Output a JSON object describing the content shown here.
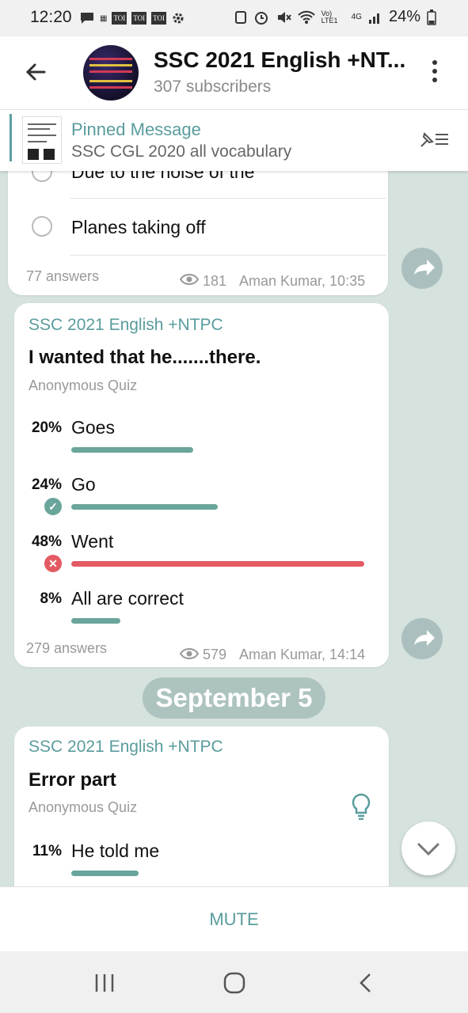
{
  "status": {
    "time": "12:20",
    "toi": "TOI",
    "battery": "24%",
    "network": "4G",
    "volte": "Vo) LTE1"
  },
  "header": {
    "title": "SSC 2021 English +NT...",
    "subscribers": "307 subscribers"
  },
  "pinned": {
    "title": "Pinned Message",
    "text": "SSC CGL 2020 all vocabulary"
  },
  "msg1": {
    "cut_option": "Due to the noise of the",
    "option": "Planes taking off",
    "answers": "77 answers",
    "views": "181",
    "author_time": "Aman Kumar, 10:35"
  },
  "msg2": {
    "channel": "SSC 2021 English +NTPC",
    "question": "I wanted that he.......there.",
    "quiz_type": "Anonymous Quiz",
    "options": [
      {
        "pct": "20%",
        "label": "Goes",
        "fraction": 0.2,
        "state": "none"
      },
      {
        "pct": "24%",
        "label": "Go",
        "fraction": 0.24,
        "state": "correct"
      },
      {
        "pct": "48%",
        "label": "Went",
        "fraction": 0.48,
        "state": "wrong"
      },
      {
        "pct": "8%",
        "label": "All are correct",
        "fraction": 0.08,
        "state": "none"
      }
    ],
    "answers": "279 answers",
    "views": "579",
    "author_time": "Aman Kumar, 14:14"
  },
  "date_divider": "September 5",
  "msg3": {
    "channel": "SSC 2021 English +NTPC",
    "question": "Error part",
    "quiz_type": "Anonymous Quiz",
    "options": [
      {
        "pct": "11%",
        "label": "He told me",
        "fraction": 0.11,
        "state": "none"
      }
    ]
  },
  "footer": {
    "mute": "MUTE"
  },
  "colors": {
    "accent": "#5a9c9d",
    "bar": "#6aa59b",
    "wrong": "#e35a62",
    "background": "#d5e2de"
  }
}
